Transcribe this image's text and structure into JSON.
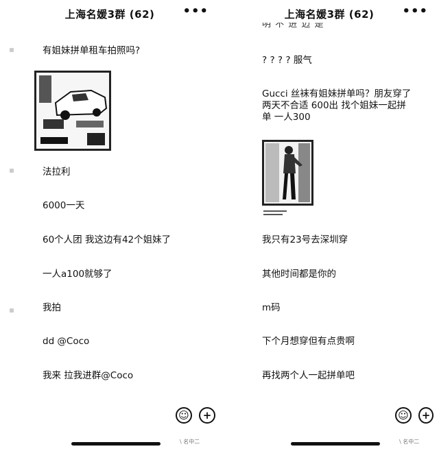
{
  "left": {
    "title": "上海名媛3群 (62)",
    "more": "•••",
    "messages": [
      "有姐妹拼单租车拍照吗?",
      "法拉利",
      "6000一天",
      "60个人团 我这边有42个姐妹了",
      "一人a100就够了",
      "我拍",
      "dd @Coco",
      "我来 拉我进群@Coco"
    ],
    "image": "car-photo",
    "footer": "\\ 名中二"
  },
  "right": {
    "title": "上海名媛3群 (62)",
    "more": "•••",
    "partial_top": "明   不   进   迈   是",
    "messages": [
      "? ? ? ?  服气",
      "Gucci 丝袜有姐妹拼单吗？朋友穿了两天不合适 600出 找个姐妹一起拼单 一人300",
      "我只有23号去深圳穿",
      "其他时间都是你的",
      "m码",
      "下个月想穿但有点贵啊",
      "再找两个人一起拼单吧"
    ],
    "image": "person-photo",
    "footer": "\\ 名中二"
  },
  "icons": {
    "emoji": "☺",
    "plus": "+"
  }
}
